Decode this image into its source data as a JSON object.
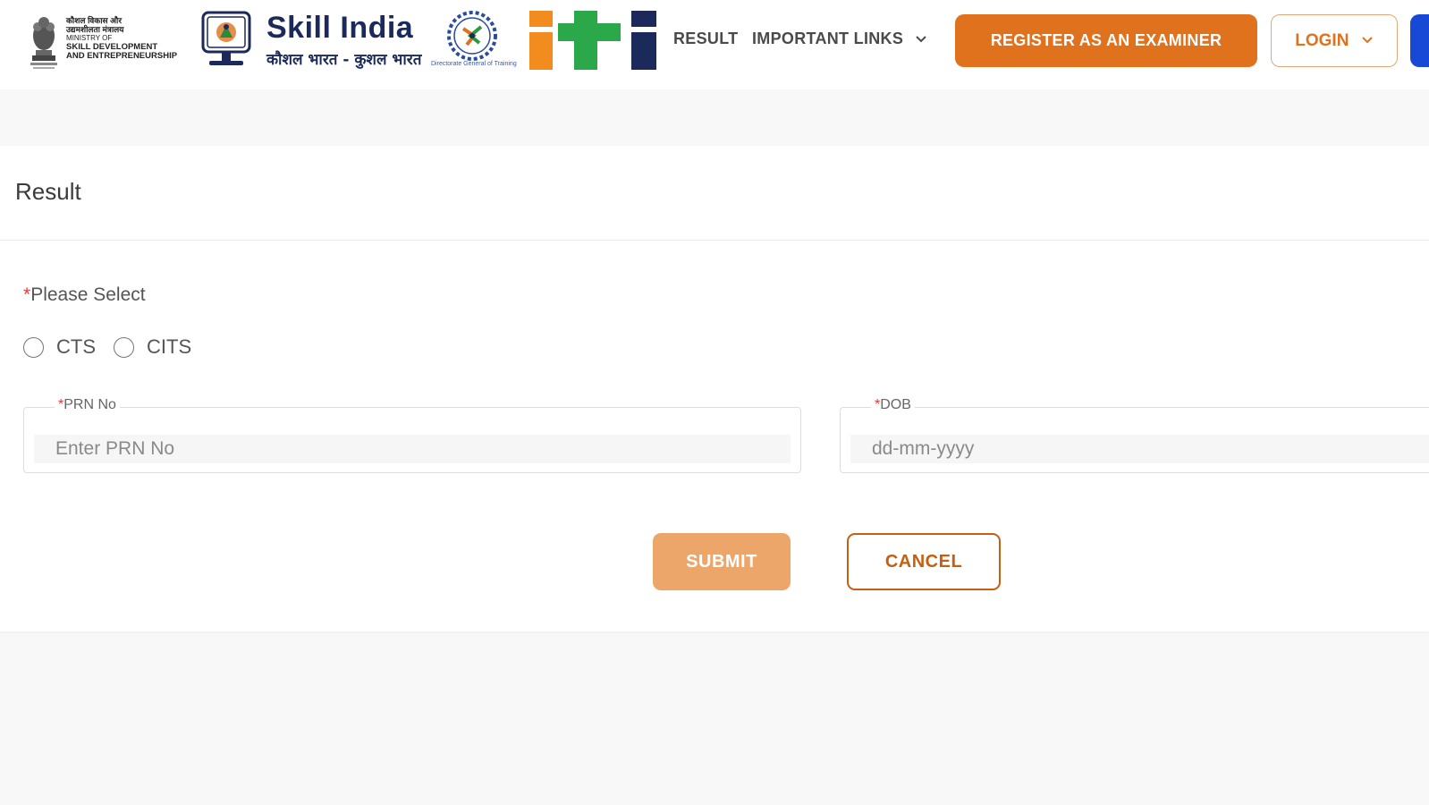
{
  "header": {
    "ministry": {
      "hindi_line1": "कौशल विकास और",
      "hindi_line2": "उद्यमशीलता मंत्रालय",
      "ministry_of": "MINISTRY OF",
      "line1": "SKILL DEVELOPMENT",
      "line2": "AND ENTREPRENEURSHIP"
    },
    "skill_india": {
      "title": "Skill India",
      "subtitle": "कौशल भारत - कुशल भारत"
    },
    "dgt_caption": "Directorate General of Training",
    "nav": {
      "result": "RESULT",
      "important_links": "IMPORTANT LINKS"
    },
    "register_label": "REGISTER AS AN EXAMINER",
    "login_label": "LOGIN"
  },
  "colors": {
    "primary_orange": "#e0711d",
    "submit_orange": "#eda66a",
    "accent_blue": "#1849d6",
    "required_red": "#e23a3a"
  },
  "form": {
    "title": "Result",
    "please_select": "Please Select",
    "options": [
      "CTS",
      "CITS"
    ],
    "prn": {
      "label": "PRN No",
      "placeholder": "Enter PRN No"
    },
    "dob": {
      "label": "DOB",
      "placeholder": "dd-mm-yyyy"
    },
    "required_mark": "*",
    "submit_label": "SUBMIT",
    "cancel_label": "CANCEL"
  }
}
